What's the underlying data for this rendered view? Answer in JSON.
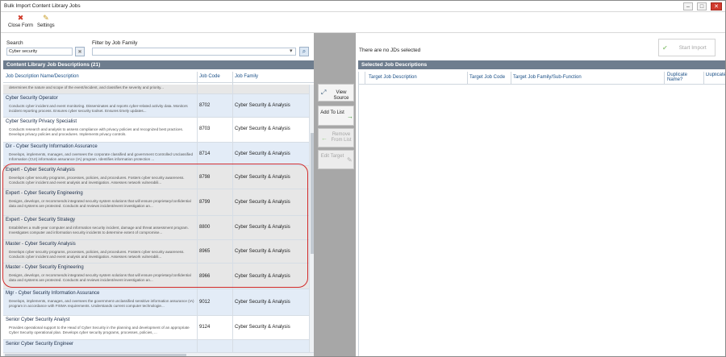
{
  "window": {
    "title": "Bulk Import Content Library Jobs",
    "min_glyph": "–",
    "max_glyph": "□",
    "close_glyph": "✕"
  },
  "ribbon": {
    "close_form_label": "Close Form",
    "close_form_icon": "✖",
    "settings_label": "Settings",
    "settings_icon": "✎"
  },
  "search": {
    "label": "Search",
    "value": "Cyber security",
    "clear_icon": "✖"
  },
  "filter": {
    "label": "Filter by Job Family",
    "value": "",
    "dropdown_icon": "▾",
    "search_icon": "⌕"
  },
  "left_panel": {
    "title": "Content Library Job Descriptions (21)",
    "columns": {
      "name": "Job Description Name/Description",
      "code": "Job Code",
      "family": "Job Family"
    },
    "rows": [
      {
        "name": "",
        "desc": "determines the nature and scope of the event/incident, and classifies the severity and priority...",
        "code": "",
        "family": ""
      },
      {
        "name": "Cyber Security Operator",
        "desc": "Conducts cyber incident and event monitoring.  Disseminates and reports cyber-related activity data.  Monitors incident reporting process.  Ensures cyber security toolset.  Ensures timely updates...",
        "code": "8702",
        "family": "Cyber Security & Analysis"
      },
      {
        "name": "Cyber Security Privacy Specialist",
        "desc": "Conducts research and analysis to assess compliance with privacy policies and recognized best practices.  Develops privacy policies and procedures.  Implements privacy controls.",
        "code": "8703",
        "family": "Cyber Security & Analysis"
      },
      {
        "name": "Dir - Cyber Security Information Assurance",
        "desc": "Develops, implements, manages, and oversees the corporate classified and government Controlled Unclassified Information (CUI) information assurance (IA) program.  Identifies information protection ...",
        "code": "8714",
        "family": "Cyber Security & Analysis"
      },
      {
        "name": "Expert - Cyber Security Analysis",
        "desc": "Develops cyber security programs, processes, policies, and procedures. Fosters cyber security awareness.  Conducts cyber incident and event analysis and investigation.  Assesses network vulnerabili...",
        "code": "8798",
        "family": "Cyber Security & Analysis"
      },
      {
        "name": "Expert - Cyber Security Engineering",
        "desc": "Designs, develops, or recommends integrated security system solutions that will ensure proprietary/confidential data and systems are protected.  Conducts and reviews incident/event investigation an...",
        "code": "8799",
        "family": "Cyber Security & Analysis"
      },
      {
        "name": "Expert - Cyber Security Strategy",
        "desc": "Establishes a multi-year computer and information security incident, damage and threat assessment program. Investigates computer and information security incidents to determine extent of compromise...",
        "code": "8800",
        "family": "Cyber Security & Analysis"
      },
      {
        "name": "Master - Cyber Security Analysis",
        "desc": "Develops cyber security programs, processes, policies, and procedures. Fosters cyber security awareness.  Conducts cyber incident and event analysis and investigation.  Assesses network vulnerabili...",
        "code": "8965",
        "family": "Cyber Security & Analysis"
      },
      {
        "name": "Master - Cyber Security Engineering",
        "desc": "Designs, develops, or recommends integrated security system solutions that will ensure proprietary/confidential data and systems are protected.  Conducts and reviews incident/event investigation an...",
        "code": "8966",
        "family": "Cyber Security & Analysis"
      },
      {
        "name": "Mgr - Cyber Security Information Assurance",
        "desc": "Develops, implements, manages, and oversees the government unclassified sensitive information assurance (IA) program in accordance with FISMA requirements.  Understands current computer technologie...",
        "code": "9012",
        "family": "Cyber Security & Analysis"
      },
      {
        "name": "Senior Cyber Security Analyst",
        "desc": "Provides operational support to the Head of Cyber Security in the planning and development of an appropriate Cyber Security operational plan. Develops cyber security programs, processes, policies, ...",
        "code": "9124",
        "family": "Cyber Security & Analysis"
      },
      {
        "name": "Senior Cyber Security Engineer",
        "desc": "",
        "code": "",
        "family": ""
      }
    ]
  },
  "actions": {
    "view_source": "View Source",
    "view_source_icon": "⤢",
    "add_to_list": "Add To List",
    "add_to_list_icon": "→",
    "remove_from_list": "Remove From List",
    "remove_icon": "←",
    "edit_target": "Edit Target",
    "edit_icon": "✎"
  },
  "right_panel": {
    "status": "There are no JDs selected",
    "start_import": "Start Import",
    "start_icon": "✔",
    "title": "Selected Job Descriptions",
    "columns": {
      "target_desc": "Target Job Description",
      "target_code": "Target Job Code",
      "target_family": "Target Job Family/Sub-Function",
      "dup_name": "Duplicate Name?",
      "dup_code": "Duplicate Code?"
    }
  }
}
